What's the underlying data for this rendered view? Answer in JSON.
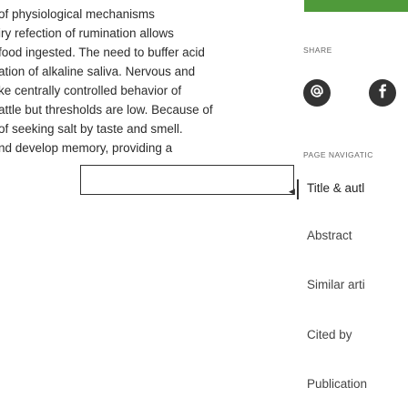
{
  "article": {
    "lines": [
      "of physiological mechanisms",
      "iry refection of rumination allows",
      "food ingested. The need to buffer acid",
      "ation of alkaline saliva. Nervous and",
      "ke centrally controlled behavior of",
      "attle but thresholds are low. Because of",
      "of seeking salt by taste and smell.",
      "nd develop memory, providing a"
    ]
  },
  "share": {
    "label": "SHARE",
    "email_icon": "at-sign-icon",
    "facebook_icon": "facebook-icon"
  },
  "page_navigation": {
    "label": "PAGE NAVIGATIC",
    "items": [
      "Title & autl",
      "Abstract",
      "Similar arti",
      "Cited by",
      "Publication"
    ]
  },
  "colors": {
    "accent_bar": "#4f9a3a",
    "icon_bg": "#333333"
  }
}
